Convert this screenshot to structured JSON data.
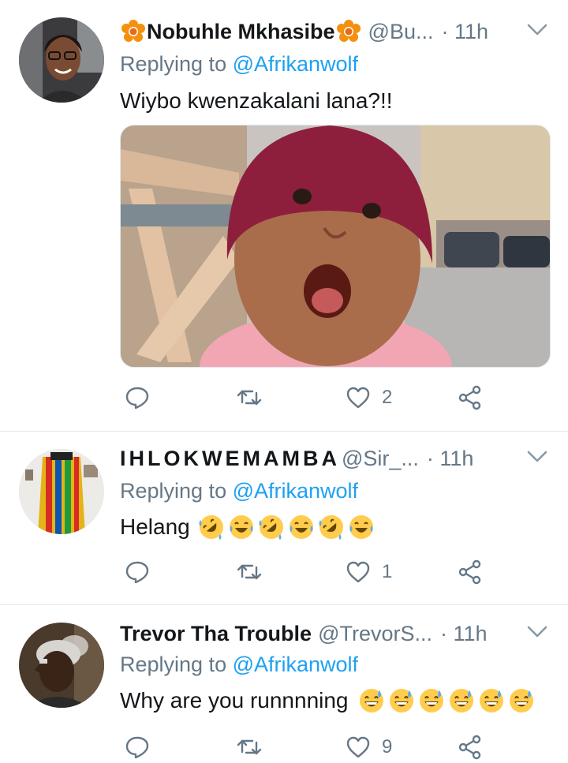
{
  "tweets": [
    {
      "name": "Nobuhle Mkhasibe",
      "handle": "@Bu...",
      "time": "· 11h",
      "replying_prefix": "Replying to ",
      "replying_to": "@Afrikanwolf",
      "text": "Wiybo kwenzakalani lana?!!",
      "has_flowers": true,
      "like_count": "2",
      "emojis": []
    },
    {
      "name": "IHLOKWEMAMBA",
      "handle": "@Sir_...",
      "time": "· 11h",
      "replying_prefix": "Replying to ",
      "replying_to": "@Afrikanwolf",
      "text": "Helang",
      "like_count": "1",
      "emojis": [
        "rolling-laughing",
        "tears-of-joy",
        "rolling-laughing",
        "tears-of-joy",
        "rolling-laughing",
        "tears-of-joy"
      ]
    },
    {
      "name": "Trevor Tha Trouble",
      "handle": "@TrevorS...",
      "time": "· 11h",
      "replying_prefix": "Replying to ",
      "replying_to": "@Afrikanwolf",
      "text": "Why are you runnnning",
      "like_count": "9",
      "emojis": [
        "grinning-sweat",
        "grinning-sweat",
        "grinning-sweat",
        "grinning-sweat",
        "grinning-sweat",
        "grinning-sweat"
      ]
    }
  ],
  "icons": {
    "reply": "reply-icon",
    "retweet": "retweet-icon",
    "like": "heart-icon",
    "share": "share-icon",
    "caret": "chevron-down-icon"
  },
  "colors": {
    "text": "#14171a",
    "secondary": "#657786",
    "link": "#1da1f2",
    "divider": "#e1e8ed"
  }
}
